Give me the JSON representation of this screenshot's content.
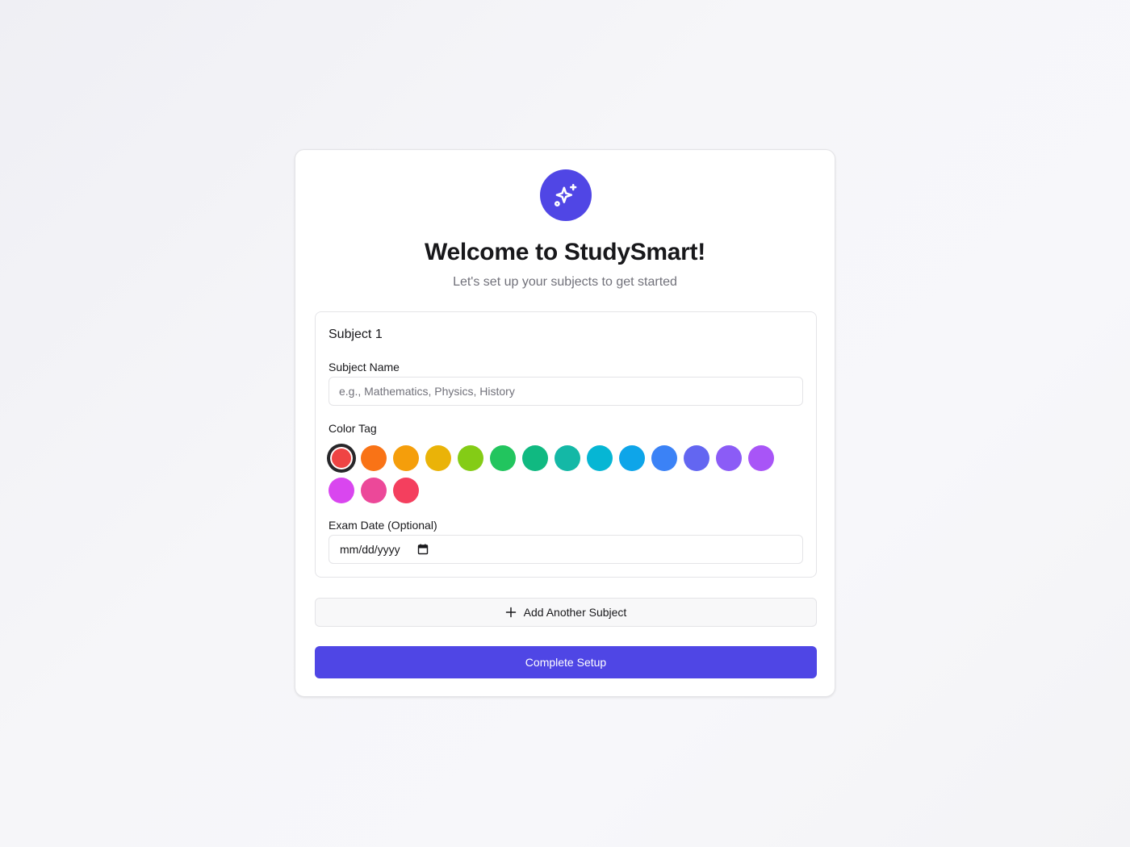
{
  "header": {
    "logo_icon": "sparkles-icon",
    "title": "Welcome to StudySmart!",
    "subtitle": "Let's set up your subjects to get started"
  },
  "subject": {
    "heading": "Subject 1",
    "name_label": "Subject Name",
    "name_placeholder": "e.g., Mathematics, Physics, History",
    "name_value": "",
    "color_label": "Color Tag",
    "colors": [
      "#ef4444",
      "#f97316",
      "#f59e0b",
      "#eab308",
      "#84cc16",
      "#22c55e",
      "#10b981",
      "#14b8a6",
      "#06b6d4",
      "#0ea5e9",
      "#3b82f6",
      "#6366f1",
      "#8b5cf6",
      "#a855f7",
      "#d946ef",
      "#ec4899",
      "#f43f5e"
    ],
    "selected_color_index": 0,
    "date_label": "Exam Date (Optional)",
    "date_placeholder": "mm/dd/yyyy",
    "date_icon": "calendar-icon"
  },
  "actions": {
    "add_subject_label": "Add Another Subject",
    "add_subject_icon": "plus-icon",
    "complete_label": "Complete Setup"
  },
  "theme": {
    "accent": "#4f46e5",
    "background": "#f5f5f8"
  }
}
